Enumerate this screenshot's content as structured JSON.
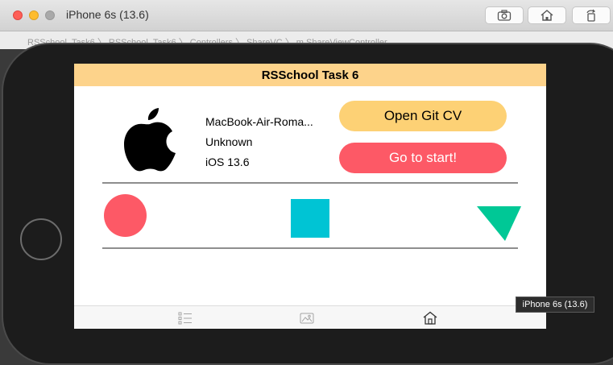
{
  "window": {
    "title": "iPhone 6s (13.6)",
    "tooltip": "iPhone 6s (13.6)"
  },
  "xcode": {
    "breadcrumb": "RSSchool_Task6  〉 RSSchool_Task6  〉 Controllers  〉 ShareVC  〉 m  ShareViewController"
  },
  "app": {
    "nav_title": "RSSchool Task 6",
    "device_info": {
      "name": "MacBook-Air-Roma...",
      "model": "Unknown",
      "os": "iOS 13.6"
    },
    "buttons": {
      "git_cv": "Open Git CV",
      "go_to_start": "Go to start!"
    },
    "shapes": [
      "circle",
      "square",
      "triangle"
    ],
    "tabs": [
      "list-icon",
      "gallery-icon",
      "home-icon"
    ],
    "selected_tab": "home-icon",
    "colors": {
      "nav": "#fdd38b",
      "git_button": "#fdd175",
      "start_button": "#fd5966",
      "circle": "#fd5966",
      "square": "#00c4d4",
      "triangle": "#00c896"
    }
  }
}
